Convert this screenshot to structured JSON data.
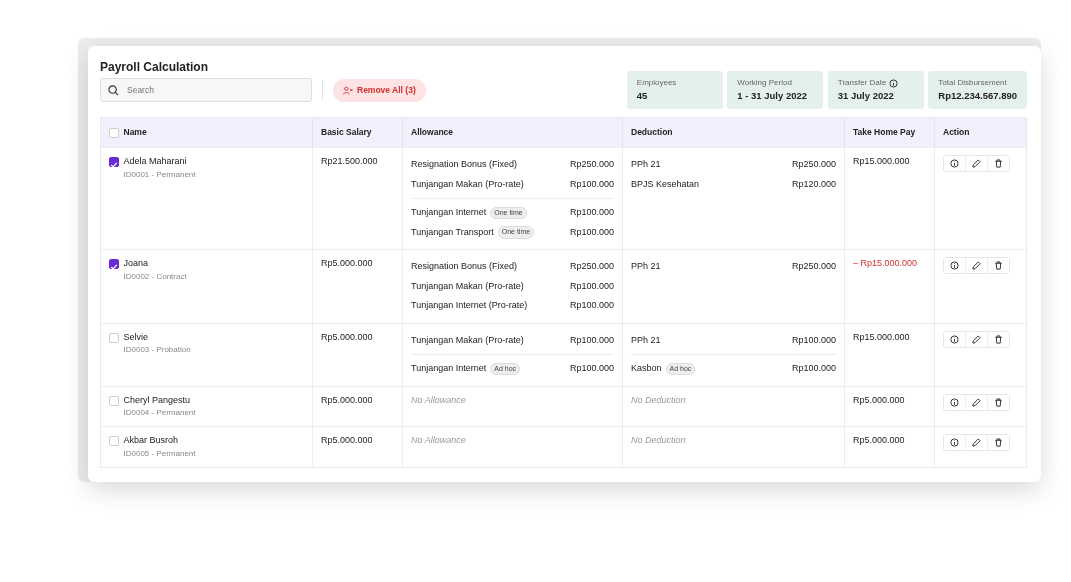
{
  "title": "Payroll Calculation",
  "search": {
    "placeholder": "Search"
  },
  "remove_button": {
    "label": "Remove All (3)"
  },
  "summary": [
    {
      "label": "Employees",
      "value": "45",
      "info": false
    },
    {
      "label": "Working Period",
      "value": "1 - 31 July 2022",
      "info": false
    },
    {
      "label": "Transfer Date",
      "value": "31 July 2022",
      "info": true
    },
    {
      "label": "Total Disbursement",
      "value": "Rp12.234.567.890",
      "info": false
    }
  ],
  "table": {
    "all_selected": false,
    "columns": [
      "Name",
      "Basic Salary",
      "Allowance",
      "Deduction",
      "Take Home Pay",
      "Action"
    ],
    "rows": [
      {
        "selected": true,
        "name": "Adela Maharani",
        "meta": "ID0001 - Permanent",
        "basic_salary": "Rp21.500.000",
        "allowance": [
          [
            {
              "label": "Resignation Bonus (Fixed)",
              "amount": "Rp250.000"
            },
            {
              "label": "Tunjangan Makan (Pro-rate)",
              "amount": "Rp100.000"
            }
          ],
          [
            {
              "label": "Tunjangan Internet",
              "tag": "One time",
              "amount": "Rp100.000"
            },
            {
              "label": "Tunjangan Transport",
              "tag": "One time",
              "amount": "Rp100.000"
            }
          ]
        ],
        "deduction": [
          [
            {
              "label": "PPh 21",
              "amount": "Rp250.000"
            },
            {
              "label": "BPJS Kesehatan",
              "amount": "Rp120.000"
            }
          ]
        ],
        "take_home_pay": "Rp15.000.000",
        "negative": false
      },
      {
        "selected": true,
        "name": "Joana",
        "meta": "ID0002 - Contract",
        "basic_salary": "Rp5.000.000",
        "allowance": [
          [
            {
              "label": "Resignation Bonus (Fixed)",
              "amount": "Rp250.000"
            },
            {
              "label": "Tunjangan Makan (Pro-rate)",
              "amount": "Rp100.000"
            },
            {
              "label": "Tunjangan Internet (Pro-rate)",
              "amount": "Rp100.000"
            }
          ]
        ],
        "deduction": [
          [
            {
              "label": "PPh 21",
              "amount": "Rp250.000"
            }
          ]
        ],
        "take_home_pay": "– Rp15.000.000",
        "negative": true
      },
      {
        "selected": false,
        "name": "Selvie",
        "meta": "ID0003 - Probation",
        "basic_salary": "Rp5.000.000",
        "allowance": [
          [
            {
              "label": "Tunjangan Makan (Pro-rate)",
              "amount": "Rp100.000"
            }
          ],
          [
            {
              "label": "Tunjangan Internet",
              "tag": "Ad hoc",
              "amount": "Rp100.000"
            }
          ]
        ],
        "deduction": [
          [
            {
              "label": "PPh 21",
              "amount": "Rp100.000"
            }
          ],
          [
            {
              "label": "Kasbon",
              "tag": "Ad hoc",
              "amount": "Rp100.000"
            }
          ]
        ],
        "take_home_pay": "Rp15.000.000",
        "negative": false
      },
      {
        "selected": false,
        "name": "Cheryl Pangestu",
        "meta": "ID0004 - Permanent",
        "basic_salary": "Rp5.000.000",
        "allowance_empty": "No Allowance",
        "deduction_empty": "No Deduction",
        "take_home_pay": "Rp5.000.000",
        "negative": false
      },
      {
        "selected": false,
        "name": "Akbar Busroh",
        "meta": "ID0005 - Permanent",
        "basic_salary": "Rp5.000.000",
        "allowance_empty": "No Allowance",
        "deduction_empty": "No Deduction",
        "take_home_pay": "Rp5.000.000",
        "negative": false
      }
    ]
  }
}
